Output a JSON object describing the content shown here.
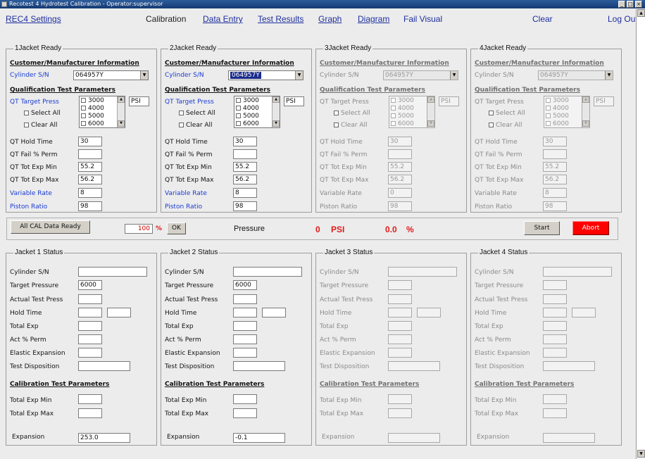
{
  "window": {
    "title": "Recotest 4 Hydrotest Calibration - Operator:supervisor"
  },
  "menu": {
    "rec4_settings": "REC4 Settings",
    "calibration": "Calibration",
    "data_entry": "Data Entry",
    "test_results": "Test Results",
    "graph": "Graph",
    "diagram": "Diagram",
    "fail_visual": "Fail Visual",
    "clear": "Clear",
    "log_out": "Log Out"
  },
  "ready_labels": {
    "customer_info": "Customer/Manufacturer Information",
    "cylinder_sn": "Cylinder S/N",
    "qual_params": "Qualification Test Parameters",
    "qt_target": "QT Target Press",
    "select_all": "Select All",
    "clear_all": "Clear All",
    "unit": "PSI",
    "qt_hold": "QT Hold Time",
    "qt_fail": "QT Fail % Perm",
    "qt_exp_min": "QT Tot Exp Min",
    "qt_exp_max": "QT Tot Exp Max",
    "variable_rate": "Variable Rate",
    "piston_ratio": "Piston Ratio"
  },
  "jackets_ready": [
    {
      "title": "1Jacket Ready",
      "cylinder": "064957Y",
      "pressures": [
        "3000",
        "4000",
        "5000",
        "6000"
      ],
      "hold": "30",
      "fail": "",
      "exp_min": "55.2",
      "exp_max": "56.2",
      "variable_rate": "8",
      "piston_ratio": "98"
    },
    {
      "title": "2Jacket Ready",
      "cylinder": "064957Y",
      "pressures": [
        "3000",
        "4000",
        "5000",
        "6000"
      ],
      "hold": "30",
      "fail": "",
      "exp_min": "55.2",
      "exp_max": "56.2",
      "variable_rate": "8",
      "piston_ratio": "98"
    },
    {
      "title": "3Jacket Ready",
      "cylinder": "064957Y",
      "pressures": [
        "3000",
        "4000",
        "5000",
        "6000"
      ],
      "hold": "30",
      "fail": "",
      "exp_min": "55.2",
      "exp_max": "56.2",
      "variable_rate": "0",
      "piston_ratio": "98"
    },
    {
      "title": "4Jacket Ready",
      "cylinder": "064957Y",
      "pressures": [
        "3000",
        "4000",
        "5000",
        "6000"
      ],
      "hold": "30",
      "fail": "",
      "exp_min": "55.2",
      "exp_max": "56.2",
      "variable_rate": "8",
      "piston_ratio": "98"
    }
  ],
  "controls": {
    "all_cal_ready": "All CAL Data Ready",
    "percent_value": "100",
    "percent_sign": "%",
    "ok": "OK",
    "pressure_label": "Pressure",
    "pressure_value": "0",
    "pressure_unit": "PSI",
    "rate_value": "0.0",
    "rate_unit": "%",
    "start": "Start",
    "abort": "Abort"
  },
  "status_labels": {
    "cylinder_sn": "Cylinder S/N",
    "target_pressure": "Target Pressure",
    "actual_test_press": "Actual Test Press",
    "hold_time": "Hold Time",
    "total_exp": "Total Exp",
    "act_perm": "Act % Perm",
    "elastic_exp": "Elastic Expansion",
    "test_disposition": "Test Disposition",
    "cal_params": "Calibration Test Parameters",
    "total_exp_min": "Total Exp Min",
    "total_exp_max": "Total Exp Max"
  },
  "jackets_status": [
    {
      "title": "Jacket 1 Status",
      "target_pressure": "6000",
      "expansion_label": "Expansion",
      "expansion": "253.0"
    },
    {
      "title": "Jacket 2 Status",
      "target_pressure": "6000",
      "expansion_label": "Expansion",
      "expansion": "-0.1"
    },
    {
      "title": "Jacket 3 Status",
      "target_pressure": "",
      "expansion_label": "Expansion",
      "expansion": ""
    },
    {
      "title": "Jacket 4 Status",
      "target_pressure": "",
      "expansion_label": "Expansion",
      "expansion": ""
    }
  ],
  "colors": {
    "link": "#1e2f9e",
    "accent_blue": "#1a3bd1",
    "abort_red": "#ff0000",
    "pressure_red": "#e01a1a"
  }
}
